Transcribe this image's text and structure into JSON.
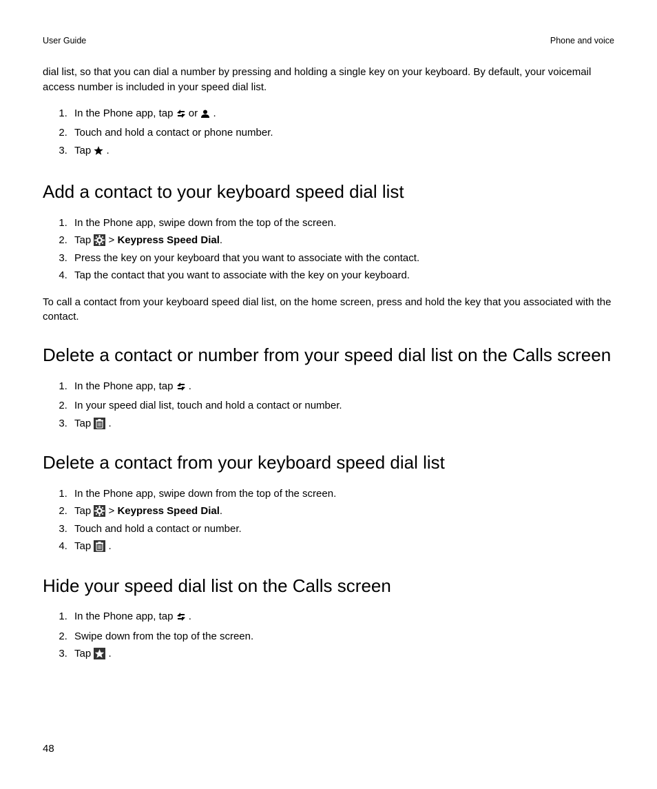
{
  "header": {
    "left": "User Guide",
    "right": "Phone and voice"
  },
  "intro": "dial list, so that you can dial a number by pressing and holding a single key on your keyboard. By default, your voicemail access number is included in your speed dial list.",
  "listA": {
    "i1a": "In the Phone app, tap ",
    "i1b": " or ",
    "i1c": " .",
    "i2": "Touch and hold a contact or phone number.",
    "i3a": "Tap ",
    "i3b": " ."
  },
  "sec1": {
    "title": "Add a contact to your keyboard speed dial list",
    "i1": "In the Phone app, swipe down from the top of the screen.",
    "i2a": "Tap ",
    "i2b": " > ",
    "i2c": "Keypress Speed Dial",
    "i2d": ".",
    "i3": "Press the key on your keyboard that you want to associate with the contact.",
    "i4": "Tap the contact that you want to associate with the key on your keyboard.",
    "after": "To call a contact from your keyboard speed dial list, on the home screen, press and hold the key that you associated with the contact."
  },
  "sec2": {
    "title": "Delete a contact or number from your speed dial list on the Calls screen",
    "i1a": "In the Phone app, tap ",
    "i1b": " .",
    "i2": "In your speed dial list, touch and hold a contact or number.",
    "i3a": "Tap ",
    "i3b": "."
  },
  "sec3": {
    "title": "Delete a contact from your keyboard speed dial list",
    "i1": "In the Phone app, swipe down from the top of the screen.",
    "i2a": "Tap ",
    "i2b": " > ",
    "i2c": "Keypress Speed Dial",
    "i2d": ".",
    "i3": "Touch and hold a contact or number.",
    "i4a": "Tap ",
    "i4b": "."
  },
  "sec4": {
    "title": "Hide your speed dial list on the Calls screen",
    "i1a": "In the Phone app, tap ",
    "i1b": " .",
    "i2": "Swipe down from the top of the screen.",
    "i3a": "Tap ",
    "i3b": "."
  },
  "pageNumber": "48"
}
